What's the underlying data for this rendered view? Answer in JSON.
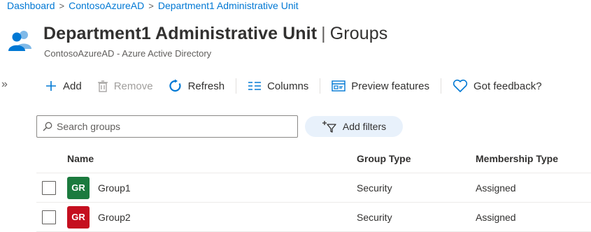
{
  "breadcrumb": {
    "items": [
      "Dashboard",
      "ContosoAzureAD",
      "Department1 Administrative Unit"
    ]
  },
  "header": {
    "title": "Department1 Administrative Unit",
    "section": "Groups",
    "subtitle": "ContosoAzureAD - Azure Active Directory",
    "icon": "users-group-icon"
  },
  "toolbar": {
    "add": "Add",
    "remove": "Remove",
    "refresh": "Refresh",
    "columns": "Columns",
    "preview": "Preview features",
    "feedback": "Got feedback?"
  },
  "search": {
    "placeholder": "Search groups",
    "value": ""
  },
  "filters": {
    "label": "Add filters"
  },
  "table": {
    "columns": [
      "Name",
      "Group Type",
      "Membership Type"
    ],
    "rows": [
      {
        "initials": "GR",
        "name": "Group1",
        "type": "Security",
        "membership": "Assigned",
        "color": "#1b7a3e"
      },
      {
        "initials": "GR",
        "name": "Group2",
        "type": "Security",
        "membership": "Assigned",
        "color": "#c50f1f"
      }
    ]
  },
  "colors": {
    "accent": "#0078d4",
    "pill_bg": "#e8f1fb"
  }
}
